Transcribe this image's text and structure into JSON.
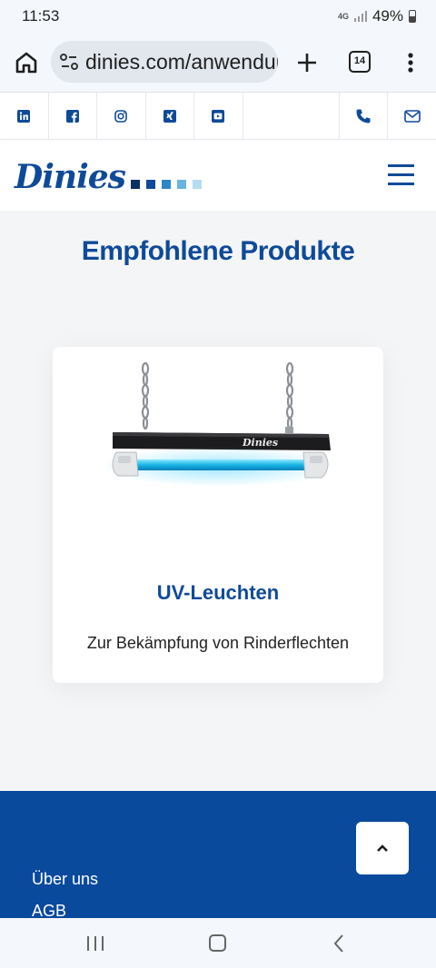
{
  "status_bar": {
    "time": "11:53",
    "network": "4G",
    "battery": "49%"
  },
  "browser": {
    "url": "dinies.com/anwendungen",
    "tab_count": "14"
  },
  "social": {
    "items": [
      "linkedin-icon",
      "facebook-icon",
      "instagram-icon",
      "xing-icon",
      "youtube-icon"
    ],
    "contact": [
      "phone-icon",
      "mail-icon"
    ]
  },
  "header": {
    "logo_text": "Dinies",
    "logo_squares": [
      "#0b2f63",
      "#0f4a98",
      "#2f86c6",
      "#6bb4e0",
      "#b5dcf2"
    ]
  },
  "main": {
    "section_title": "Empfohlene Produkte",
    "product": {
      "title": "UV-Leuchten",
      "description": "Zur Bekämpfung von Rinderflechten",
      "lamp_brand": "Dinies"
    }
  },
  "footer": {
    "links": [
      "Über uns",
      "AGB"
    ]
  },
  "colors": {
    "brand": "#0f4a98",
    "footer_bg": "#0a4a9c"
  }
}
